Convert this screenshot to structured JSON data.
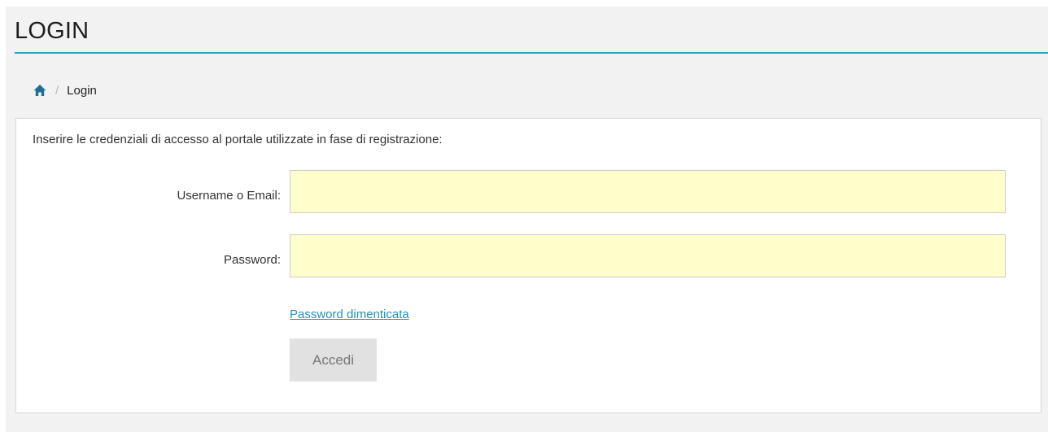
{
  "header": {
    "title": "LOGIN"
  },
  "breadcrumb": {
    "home_icon": "home-icon",
    "separator": "/",
    "current": "Login"
  },
  "form": {
    "intro": "Inserire le credenziali di accesso al portale utilizzate in fase di registrazione:",
    "username": {
      "label": "Username o Email:",
      "value": "",
      "placeholder": ""
    },
    "password": {
      "label": "Password:",
      "value": "",
      "placeholder": ""
    },
    "forgot_link": "Password dimenticata",
    "submit_label": "Accedi"
  },
  "colors": {
    "accent": "#2ea1bd",
    "link": "#2a8fb0",
    "home_icon": "#1f6f90",
    "input_background": "#ffffcc",
    "button_background": "#e1e1e1",
    "page_background": "#f2f2f2"
  }
}
